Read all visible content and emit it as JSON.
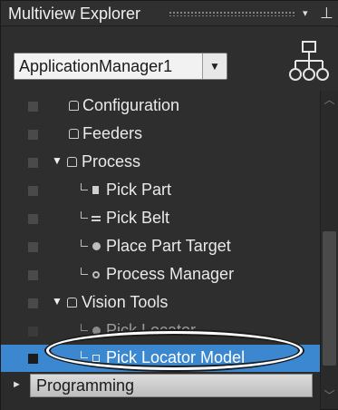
{
  "window": {
    "title": "Multiview Explorer",
    "dropdown_glyph": "▾",
    "pin_glyph": "⊥"
  },
  "header": {
    "application_select": {
      "value": "ApplicationManager1",
      "arrow": "▼"
    },
    "hierarchy_icon": "hierarchy-icon"
  },
  "tree": {
    "items": [
      {
        "label": "Configuration",
        "icon": "folder-icon",
        "expander": ""
      },
      {
        "label": "Feeders",
        "icon": "folder-icon",
        "expander": ""
      },
      {
        "label": "Process",
        "icon": "folder-icon",
        "expander": "▼"
      },
      {
        "label": "Pick Part",
        "icon": "part-icon",
        "expander": ""
      },
      {
        "label": "Pick Belt",
        "icon": "belt-icon",
        "expander": ""
      },
      {
        "label": "Place Part Target",
        "icon": "target-icon",
        "expander": ""
      },
      {
        "label": "Process Manager",
        "icon": "manager-icon",
        "expander": ""
      },
      {
        "label": "Vision Tools",
        "icon": "folder-icon",
        "expander": "▼"
      },
      {
        "label": "Pick Locator",
        "icon": "locator-icon",
        "expander": ""
      },
      {
        "label": "Pick Locator Model",
        "icon": "model-icon",
        "expander": "",
        "selected": true
      }
    ]
  },
  "sections": {
    "programming": {
      "label": "Programming",
      "expander": "►"
    }
  },
  "colors": {
    "selection": "#3c88d0",
    "panel_bg": "#2e2e2e",
    "text": "#eaeaea"
  }
}
